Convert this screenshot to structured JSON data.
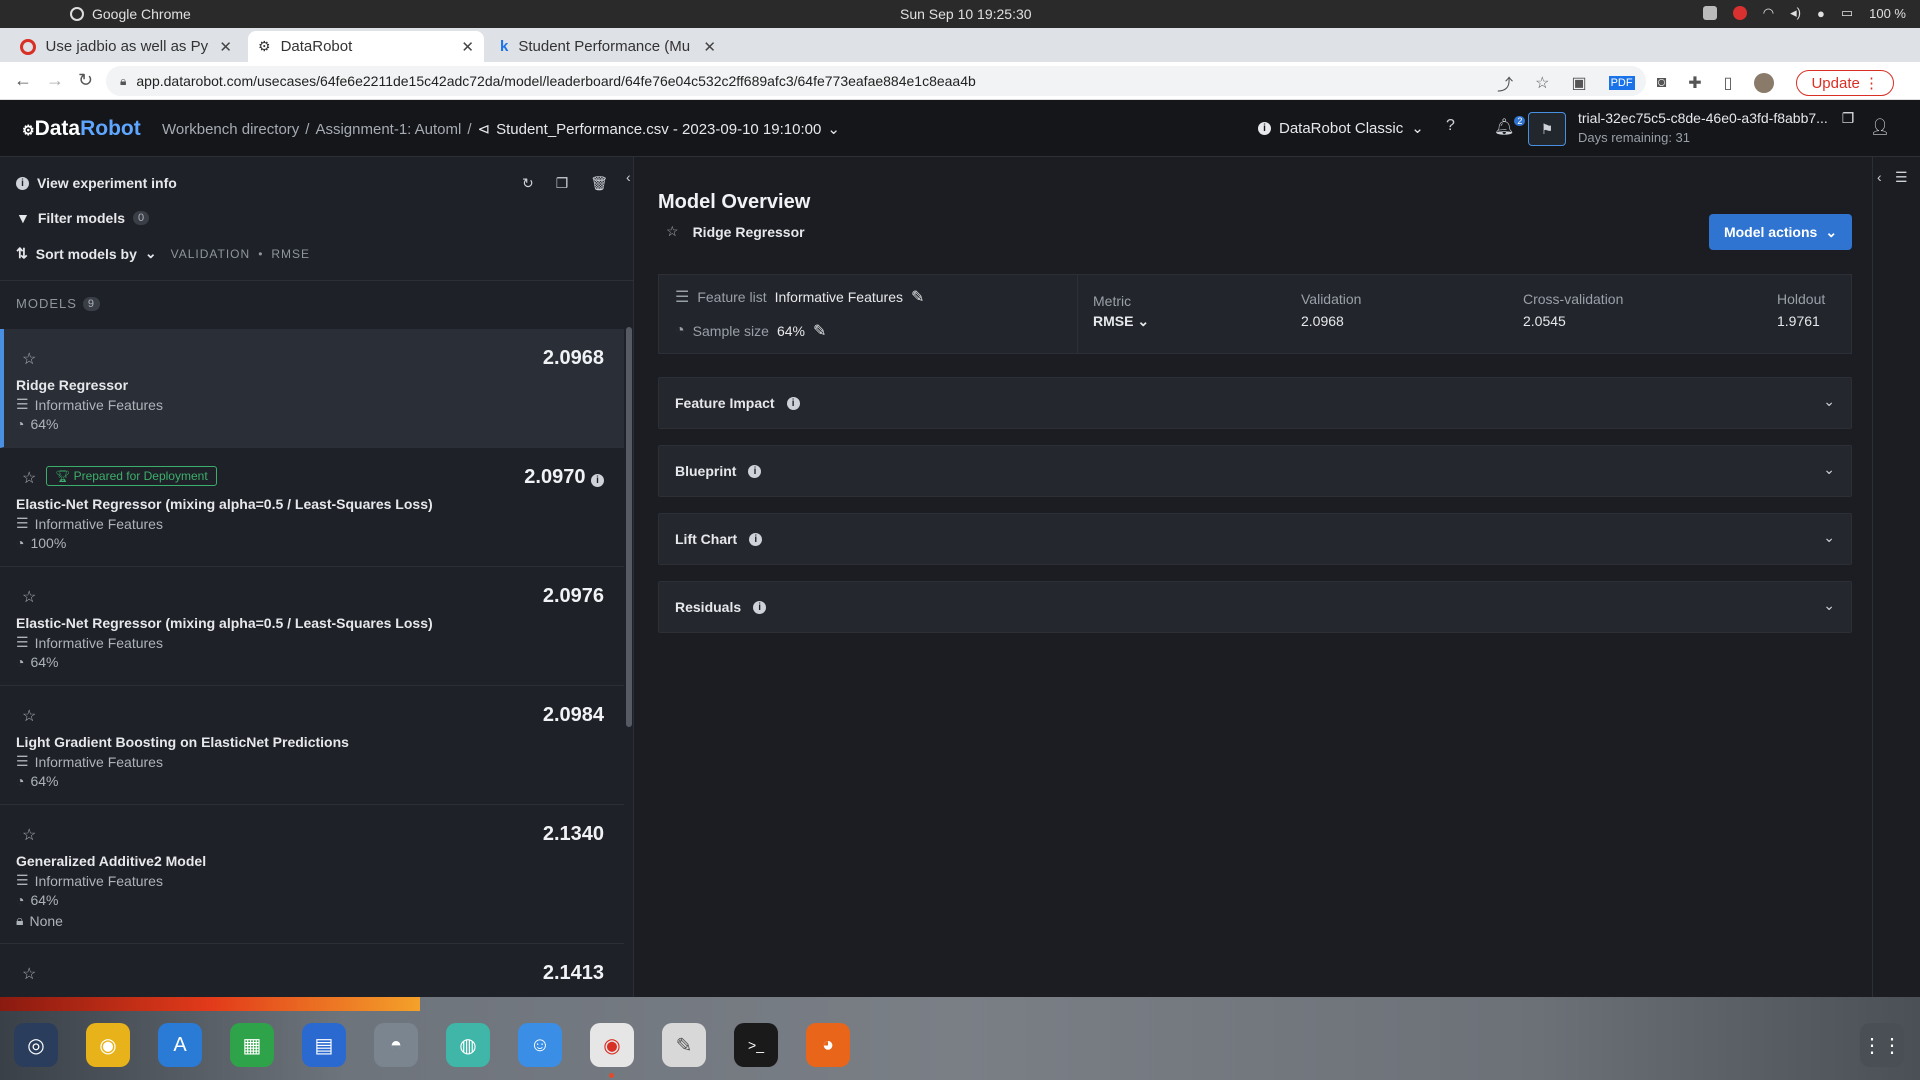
{
  "os": {
    "app_name": "Google Chrome",
    "clock": "Sun Sep 10  19:25:30",
    "battery": "100 %"
  },
  "browser": {
    "tabs": [
      {
        "label": "Use jadbio as well as PyCa",
        "active": false
      },
      {
        "label": "DataRobot",
        "active": true
      },
      {
        "label": "Student Performance (Mu",
        "active": false
      }
    ],
    "url": "app.datarobot.com/usecases/64fe6e2211de15c42adc72da/model/leaderboard/64fe76e04c532c2ff689afc3/64fe773eafae884e1c8eaa4b",
    "update_label": "Update"
  },
  "header": {
    "brand_data": "Data",
    "brand_robot": "Robot",
    "breadcrumb": {
      "workbench": "Workbench directory",
      "sep1": "/",
      "assignment": "Assignment-1: Automl",
      "sep2": "/",
      "current": "Student_Performance.csv - 2023-09-10 19:10:00"
    },
    "classic_label": "DataRobot Classic",
    "notification_count": "2",
    "trial_id": "trial-32ec75c5-c8de-46e0-a3fd-f8abb7...",
    "days_remaining": "Days remaining: 31"
  },
  "left_panel": {
    "view_experiment": "View experiment info",
    "filter_models": "Filter models",
    "filter_count": "0",
    "sort_models": "Sort models by",
    "sort_partition": "VALIDATION",
    "sort_dot": "•",
    "sort_metric": "RMSE",
    "models_header": "MODELS",
    "models_count": "9",
    "models": [
      {
        "name": "Ridge Regressor",
        "score": "2.0968",
        "feature_list": "Informative Features",
        "sample": "64%",
        "selected": true
      },
      {
        "name": "Elastic-Net Regressor (mixing alpha=0.5 / Least-Squares Loss)",
        "score": "2.0970",
        "feature_list": "Informative Features",
        "sample": "100%",
        "badge": "Prepared for Deployment"
      },
      {
        "name": "Elastic-Net Regressor (mixing alpha=0.5 / Least-Squares Loss)",
        "score": "2.0976",
        "feature_list": "Informative Features",
        "sample": "64%"
      },
      {
        "name": "Light Gradient Boosting on ElasticNet Predictions",
        "score": "2.0984",
        "feature_list": "Informative Features",
        "sample": "64%"
      },
      {
        "name": "Generalized Additive2 Model",
        "score": "2.1340",
        "feature_list": "Informative Features",
        "sample": "64%",
        "constraint": "None"
      },
      {
        "name": "",
        "score": "2.1413"
      }
    ]
  },
  "main": {
    "title": "Model Overview",
    "model_name": "Ridge Regressor",
    "actions_label": "Model actions",
    "feature_list_label": "Feature list",
    "feature_list_value": "Informative Features",
    "sample_size_label": "Sample size",
    "sample_size_value": "64%",
    "metric_label": "Metric",
    "metric_value": "RMSE",
    "validation_label": "Validation",
    "validation_value": "2.0968",
    "cv_label": "Cross-validation",
    "cv_value": "2.0545",
    "holdout_label": "Holdout",
    "holdout_value": "1.9761",
    "sections": [
      "Feature Impact",
      "Blueprint",
      "Lift Chart",
      "Residuals"
    ]
  },
  "colors": {
    "accent": "#2f74d0",
    "deploy_green": "#3cae6b",
    "background": "#1b1d22"
  }
}
